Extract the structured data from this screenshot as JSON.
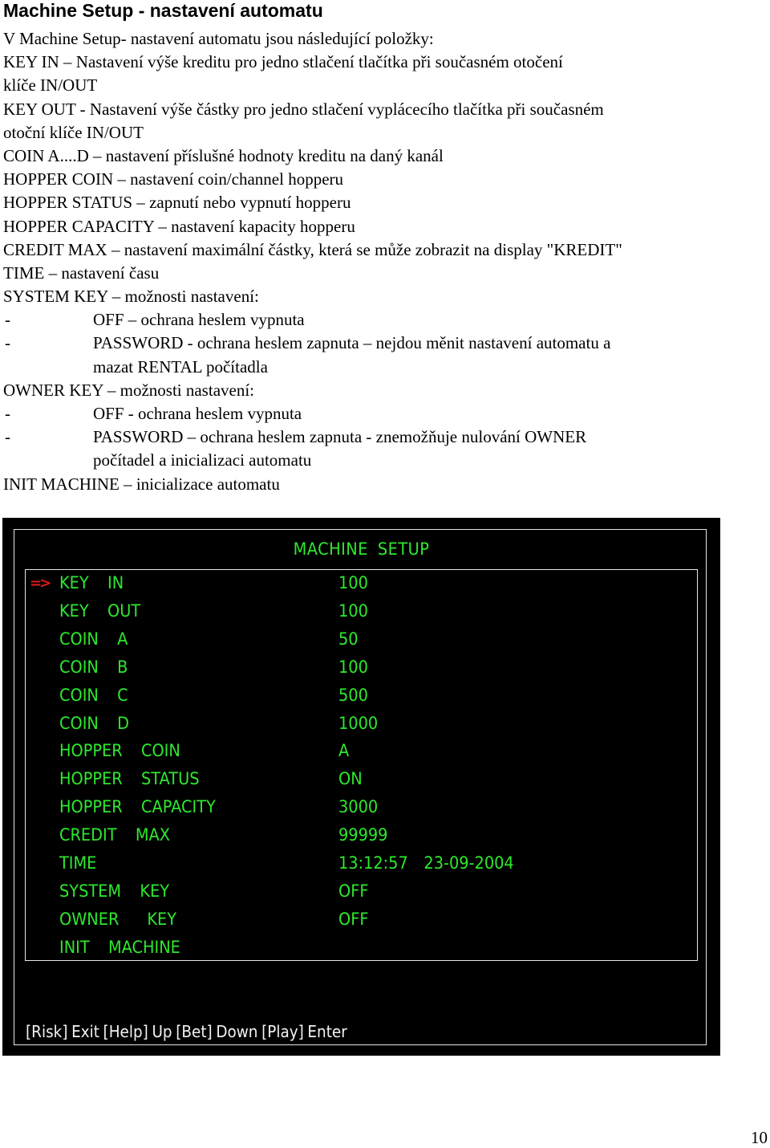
{
  "heading": "Machine Setup - nastavení automatu",
  "intro": "V Machine Setup- nastavení automatu jsou následující položky:",
  "lines": [
    {
      "type": "text",
      "text": "KEY IN – Nastavení výše kreditu pro jedno stlačení tlačítka  při  současném  otočení"
    },
    {
      "type": "text",
      "text": "klíče   IN/OUT"
    },
    {
      "type": "text",
      "text": "KEY OUT - Nastavení výše částky pro jedno stlačení vyplácecího tlačítka při současném"
    },
    {
      "type": "text",
      "text": "otoční klíče IN/OUT"
    },
    {
      "type": "text",
      "text": "COIN A....D – nastavení příslušné hodnoty kreditu na daný kanál"
    },
    {
      "type": "text",
      "text": "HOPPER COIN – nastavení coin/channel hopperu"
    },
    {
      "type": "text",
      "text": "HOPPER STATUS – zapnutí nebo vypnutí hopperu"
    },
    {
      "type": "text",
      "text": "HOPPER CAPACITY – nastavení kapacity hopperu"
    },
    {
      "type": "text",
      "text": "CREDIT MAX – nastavení maximální částky, která se může zobrazit na display \"KREDIT\""
    },
    {
      "type": "text",
      "text": "TIME – nastavení času"
    },
    {
      "type": "text",
      "text": "SYSTEM KEY – možnosti nastavení:"
    },
    {
      "type": "bullet",
      "dash": "-",
      "text": "OFF – ochrana heslem vypnuta"
    },
    {
      "type": "bullet",
      "dash": "-",
      "text": "PASSWORD - ochrana heslem zapnuta – nejdou měnit nastavení automatu a"
    },
    {
      "type": "cont",
      "text": "mazat RENTAL počítadla"
    },
    {
      "type": "text",
      "text": "OWNER KEY – možnosti nastavení:"
    },
    {
      "type": "bullet",
      "dash": "-",
      "text": "OFF - ochrana heslem vypnuta"
    },
    {
      "type": "bullet",
      "dash": "-",
      "text": "PASSWORD – ochrana heslem zapnuta - znemožňuje nulování  OWNER"
    },
    {
      "type": "cont",
      "text": "počítadel a inicializaci automatu"
    },
    {
      "type": "text",
      "text": "INIT MACHINE – inicializace automatu"
    }
  ],
  "screen": {
    "title": "MACHINE SETUP",
    "cursor": "=>",
    "selected_index": 0,
    "text_color": "#2ee82e",
    "cursor_color": "#e01818",
    "rows": [
      {
        "label": "KEY  IN",
        "value": "100"
      },
      {
        "label": "KEY  OUT",
        "value": "100"
      },
      {
        "label": "COIN  A",
        "value": "50"
      },
      {
        "label": "COIN  B",
        "value": "100"
      },
      {
        "label": "COIN  C",
        "value": "500"
      },
      {
        "label": "COIN  D",
        "value": "1000"
      },
      {
        "label": "HOPPER  COIN",
        "value": "A"
      },
      {
        "label": "HOPPER  STATUS",
        "value": "ON"
      },
      {
        "label": "HOPPER  CAPACITY",
        "value": "3000"
      },
      {
        "label": "CREDIT  MAX",
        "value": "99999"
      },
      {
        "label": "TIME",
        "value": "13:12:57  23-09-2004"
      },
      {
        "label": "SYSTEM  KEY",
        "value": "OFF"
      },
      {
        "label": "OWNER   KEY",
        "value": "OFF"
      },
      {
        "label": "INIT  MACHINE",
        "value": ""
      }
    ],
    "footer": [
      {
        "key": "[Risk]",
        "action": "Exit"
      },
      {
        "key": "[Help]",
        "action": "Up"
      },
      {
        "key": "[Bet]",
        "action": "Down"
      },
      {
        "key": "[Play]",
        "action": "Enter"
      }
    ]
  },
  "page_number": "10"
}
